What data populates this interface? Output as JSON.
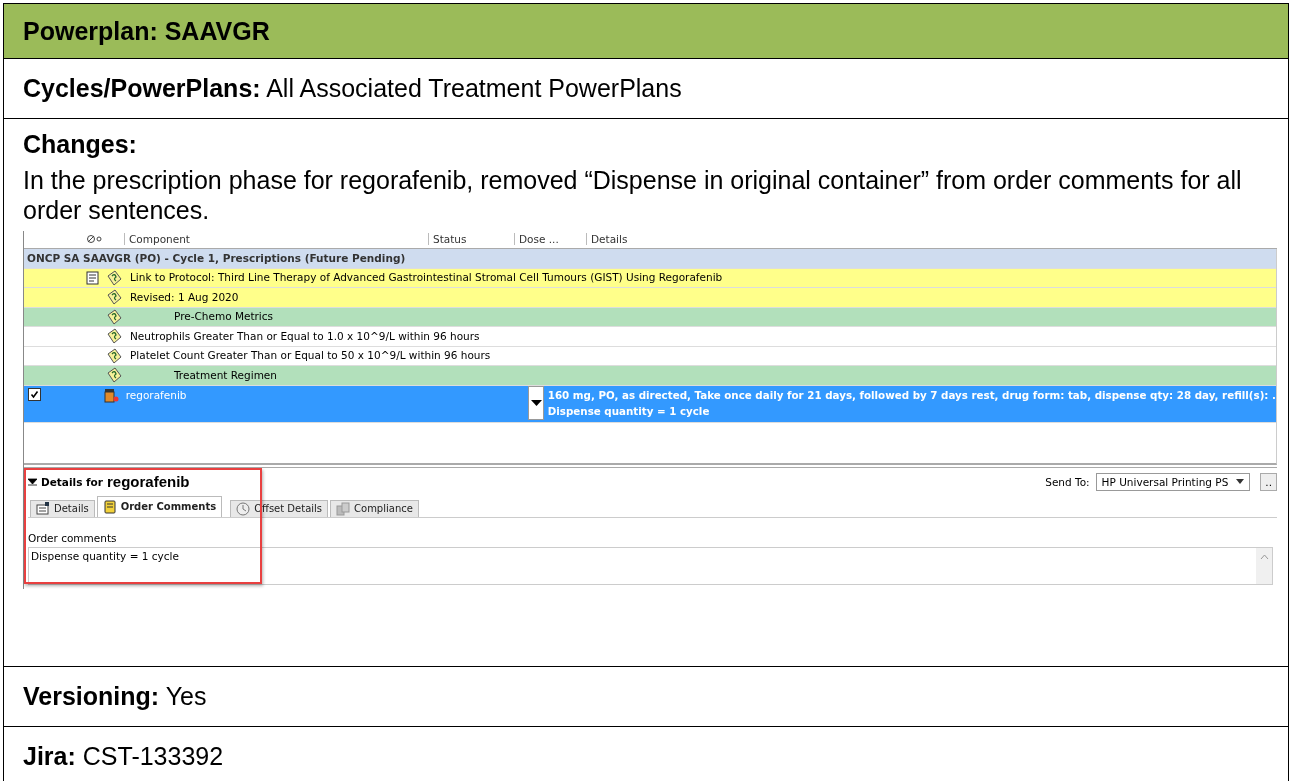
{
  "title": "Powerplan: SAAVGR",
  "cycles": {
    "label": "Cycles/PowerPlans:",
    "value": "All Associated Treatment PowerPlans"
  },
  "changes": {
    "label": "Changes:",
    "text": "In the prescription phase for regorafenib, removed “Dispense in original container” from order comments for all order sentences."
  },
  "screenshot": {
    "columns": [
      "Component",
      "Status",
      "Dose ...",
      "Details"
    ],
    "rows": [
      {
        "kind": "group",
        "text": "ONCP SA SAAVGR (PO) - Cycle 1, Prescriptions (Future Pending)"
      },
      {
        "kind": "link",
        "text": "Link to Protocol: Third Line Therapy of Advanced Gastrointestinal Stromal Cell Tumours (GIST) Using Regorafenib"
      },
      {
        "kind": "info",
        "text": "Revised: 1 Aug 2020"
      },
      {
        "kind": "section",
        "text": "Pre-Chemo Metrics"
      },
      {
        "kind": "criteria",
        "text": "Neutrophils Greater Than or Equal to 1.0 x 10^9/L within 96 hours"
      },
      {
        "kind": "criteria",
        "text": "Platelet Count Greater Than or Equal to 50 x 10^9/L within 96 hours"
      },
      {
        "kind": "section",
        "text": "Treatment Regimen"
      },
      {
        "kind": "order",
        "text": "regorafenib",
        "checked": true,
        "selected": true,
        "details": [
          "160 mg, PO, as directed, Take once daily for 21 days, followed by 7 days rest, drug form: tab, dispense qty: 28 day, refill(s): .",
          "Dispense quantity = 1 cycle"
        ]
      }
    ],
    "details_title": "Details for",
    "details_name": "regorafenib",
    "send_to": {
      "label": "Send To:",
      "value": "HP Universal Printing PS",
      "more": ".."
    },
    "tabs": [
      {
        "label": "Details",
        "selected": false
      },
      {
        "label": "Order Comments",
        "selected": true
      },
      {
        "label": "Offset Details",
        "selected": false
      },
      {
        "label": "Compliance",
        "selected": false
      }
    ],
    "comments_label": "Order comments",
    "comments_value": "Dispense quantity = 1 cycle"
  },
  "versioning": {
    "label": "Versioning:",
    "value": "Yes"
  },
  "jira": {
    "label": "Jira:",
    "value": "CST-133392"
  }
}
